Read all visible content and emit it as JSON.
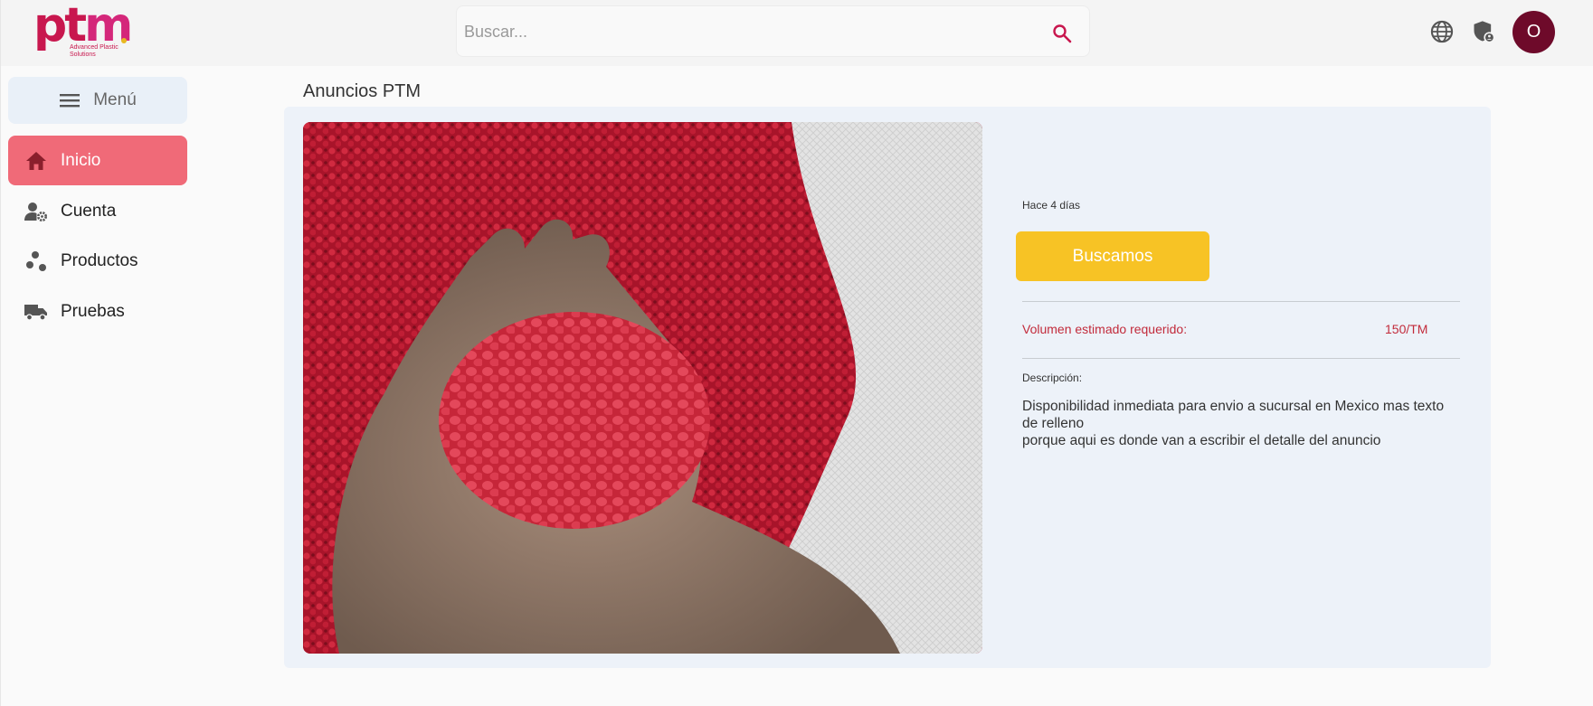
{
  "header": {
    "logo_text": "ptm",
    "logo_tagline": "Advanced Plastic Solutions",
    "search_placeholder": "Buscar...",
    "avatar_initial": "O"
  },
  "sidebar": {
    "menu_label": "Menú",
    "items": [
      {
        "label": "Inicio",
        "icon": "home-icon",
        "active": true
      },
      {
        "label": "Cuenta",
        "icon": "user-settings-icon",
        "active": false
      },
      {
        "label": "Productos",
        "icon": "scatter-dots-icon",
        "active": false
      },
      {
        "label": "Pruebas",
        "icon": "truck-icon",
        "active": false
      }
    ]
  },
  "main": {
    "title": "Anuncios PTM",
    "ad": {
      "time_ago": "Hace 4 días",
      "badge": "Buscamos",
      "volume_label": "Volumen estimado requerido:",
      "volume_value": "150/TM",
      "description_label": "Descripción:",
      "description_lines": [
        "Disponibilidad inmediata para envio a sucursal en Mexico mas texto de relleno",
        "porque aqui es donde van a escribir el detalle del anuncio"
      ]
    }
  },
  "colors": {
    "brand": "#c8174e",
    "active_nav": "#f06a78",
    "badge": "#f7c325",
    "avatar": "#6e0a2a",
    "card_bg": "#edf2f9"
  }
}
